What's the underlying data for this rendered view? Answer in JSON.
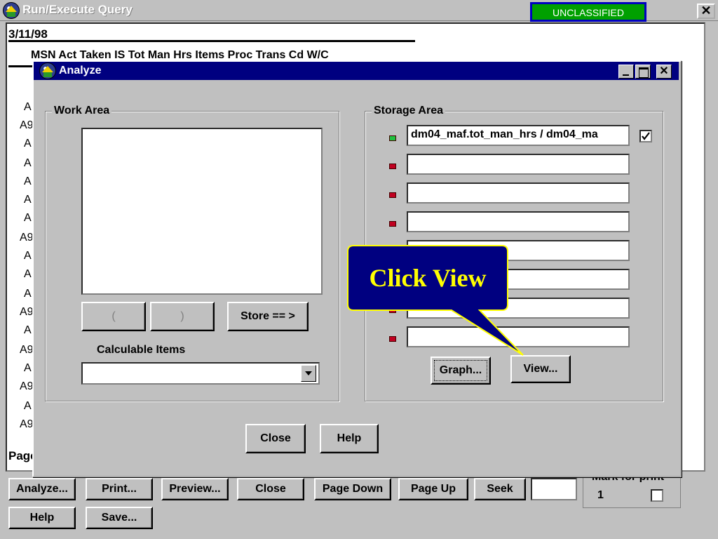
{
  "outer_window": {
    "title": "Run/Execute Query",
    "banner": "UNCLASSIFIED",
    "close_glyph": "✕",
    "report": {
      "date": "3/11/98",
      "header": "MSN      Act Taken      IS      Tot Man Hrs Items Proc Trans Cd     W/C",
      "row_tags": [
        "A",
        "A9",
        "A",
        "A",
        "A",
        "A",
        "A",
        "A9",
        "A",
        "A",
        "A",
        "A9",
        "A",
        "A9",
        "A",
        "A9",
        "A",
        "A9"
      ],
      "page_label": "Page"
    },
    "buttons": [
      {
        "label": "Analyze...",
        "mnemonic": "A"
      },
      {
        "label": "Print...",
        "mnemonic": "P"
      },
      {
        "label": "Preview...",
        "mnemonic": "r"
      },
      {
        "label": "Close",
        "mnemonic": ""
      },
      {
        "label": "Page Down",
        "mnemonic": "D"
      },
      {
        "label": "Page Up",
        "mnemonic": "U"
      },
      {
        "label": "Seek",
        "mnemonic": "k"
      },
      {
        "label": "Help",
        "mnemonic": "H"
      },
      {
        "label": "Save...",
        "mnemonic": "S"
      }
    ],
    "mark_for_print": {
      "label": "Mark for print",
      "value": "1",
      "checked": false
    }
  },
  "dialog": {
    "title": "Analyze",
    "work_area": {
      "label": "Work Area",
      "open_paren_label": "(",
      "close_paren_label": ")",
      "store_label": "Store == >",
      "calculable_items_label": "Calculable Items",
      "calculable_items_value": ""
    },
    "storage_area": {
      "label": "Storage Area",
      "slots": [
        {
          "value": "dm04_maf.tot_man_hrs / dm04_ma",
          "status": "green",
          "checked": true
        },
        {
          "value": "",
          "status": "red"
        },
        {
          "value": "",
          "status": "red"
        },
        {
          "value": "",
          "status": "red"
        },
        {
          "value": "",
          "status": "red"
        },
        {
          "value": "",
          "status": "red"
        },
        {
          "value": "",
          "status": "red"
        },
        {
          "value": "",
          "status": "red"
        }
      ],
      "graph_label": "Graph...",
      "view_label": "View..."
    },
    "close_label": "Close",
    "help_label": "Help"
  },
  "callout": {
    "text": "Click View"
  },
  "colors": {
    "dialog_titlebar": "#000080",
    "banner_bg": "#00a000",
    "banner_border": "#0000c0",
    "callout_bg": "#000080",
    "callout_text": "#ffff00",
    "led_green": "#20c040",
    "led_red": "#c00020"
  }
}
